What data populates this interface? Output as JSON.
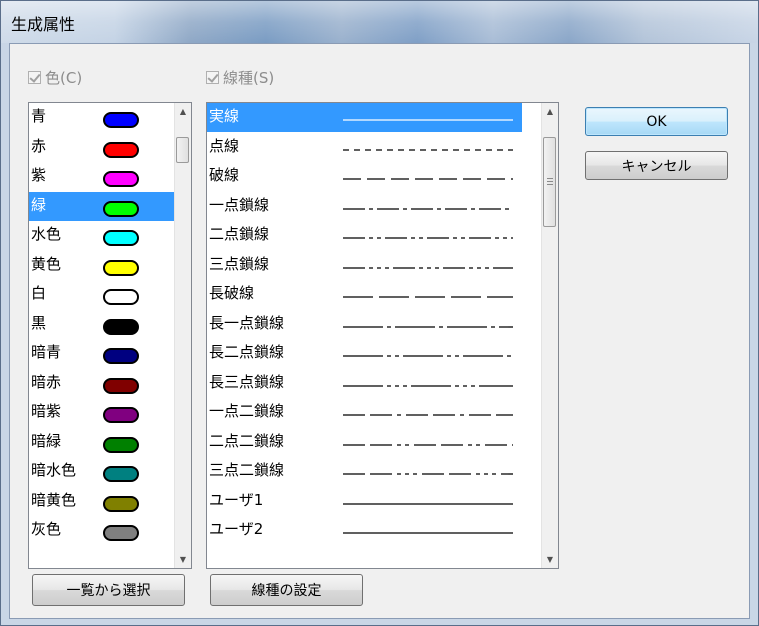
{
  "window": {
    "title": "生成属性"
  },
  "color_panel": {
    "checkbox_label": "色(C)",
    "items": [
      {
        "label": "青",
        "color": "#0000ff"
      },
      {
        "label": "赤",
        "color": "#ff0000"
      },
      {
        "label": "紫",
        "color": "#ff00ff"
      },
      {
        "label": "緑",
        "color": "#00ff00"
      },
      {
        "label": "水色",
        "color": "#00ffff"
      },
      {
        "label": "黄色",
        "color": "#ffff00"
      },
      {
        "label": "白",
        "color": "#ffffff"
      },
      {
        "label": "黒",
        "color": "#000000"
      },
      {
        "label": "暗青",
        "color": "#000080"
      },
      {
        "label": "暗赤",
        "color": "#800000"
      },
      {
        "label": "暗紫",
        "color": "#800080"
      },
      {
        "label": "暗緑",
        "color": "#008000"
      },
      {
        "label": "暗水色",
        "color": "#008080"
      },
      {
        "label": "暗黄色",
        "color": "#808000"
      },
      {
        "label": "灰色",
        "color": "#808080"
      }
    ],
    "selected_index": 3,
    "select_button_label": "一覧から選択"
  },
  "linetype_panel": {
    "checkbox_label": "線種(S)",
    "items": [
      {
        "label": "実線",
        "pattern": "none"
      },
      {
        "label": "点線",
        "pattern": "6 5"
      },
      {
        "label": "破線",
        "pattern": "18 6"
      },
      {
        "label": "一点鎖線",
        "pattern": "22 4 4 4"
      },
      {
        "label": "二点鎖線",
        "pattern": "22 4 4 4 4 4"
      },
      {
        "label": "三点鎖線",
        "pattern": "22 4 4 4 4 4 4 4"
      },
      {
        "label": "長破線",
        "pattern": "30 6"
      },
      {
        "label": "長一点鎖線",
        "pattern": "40 4 4 4"
      },
      {
        "label": "長二点鎖線",
        "pattern": "40 4 4 4 4 4"
      },
      {
        "label": "長三点鎖線",
        "pattern": "40 4 4 4 4 4 4 4"
      },
      {
        "label": "一点二鎖線",
        "pattern": "22 5 22 5 4 5"
      },
      {
        "label": "二点二鎖線",
        "pattern": "22 5 22 5 4 4 4 5"
      },
      {
        "label": "三点二鎖線",
        "pattern": "22 5 22 5 4 4 4 4 4 5"
      },
      {
        "label": "ユーザ1",
        "pattern": "none"
      },
      {
        "label": "ユーザ2",
        "pattern": "none"
      }
    ],
    "selected_index": 0,
    "settings_button_label": "線種の設定"
  },
  "buttons": {
    "ok": "OK",
    "cancel": "キャンセル"
  }
}
